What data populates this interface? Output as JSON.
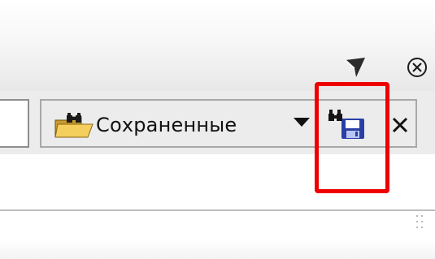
{
  "window": {
    "header_buttons": [
      {
        "icon": "arrow-cursor-icon"
      },
      {
        "icon": "close-circle-icon"
      }
    ]
  },
  "toolbar": {
    "saved_searches": {
      "icon": "saved-search-folder-icon",
      "label": "Сохраненные",
      "dropdown_icon": "chevron-down-icon"
    },
    "save_search": {
      "icon": "save-search-icon",
      "highlighted": true
    },
    "close": {
      "label": "×",
      "icon": "close-icon"
    }
  },
  "colors": {
    "highlight": "#ee0000",
    "floppy_blue": "#2a3fa6",
    "toolbar_bg": "#ececec"
  }
}
